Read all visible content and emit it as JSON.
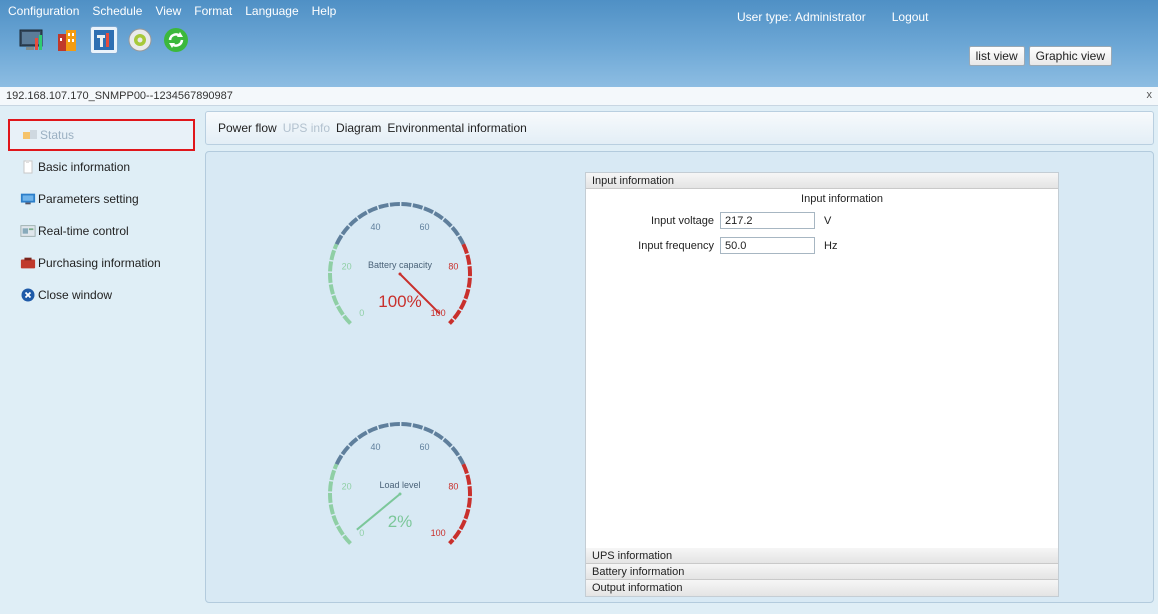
{
  "menu": [
    "Configuration",
    "Schedule",
    "View",
    "Format",
    "Language",
    "Help"
  ],
  "user": {
    "type_label": "User type:",
    "type_value": "Administrator",
    "logout": "Logout"
  },
  "toolbar_icons": [
    "monitor-chart-icon",
    "building-icon",
    "tools-icon",
    "gear-disc-icon",
    "refresh-icon"
  ],
  "view_buttons": {
    "list": "list view",
    "graphic": "Graphic view"
  },
  "address": "192.168.107.170_SNMPP00--1234567890987",
  "close_label": "x",
  "sidebar": [
    {
      "label": "Status",
      "icon": "status-icon",
      "active": true
    },
    {
      "label": "Basic information",
      "icon": "document-icon"
    },
    {
      "label": "Parameters setting",
      "icon": "monitor-icon"
    },
    {
      "label": "Real-time control",
      "icon": "control-icon"
    },
    {
      "label": "Purchasing information",
      "icon": "cart-icon"
    },
    {
      "label": "Close window",
      "icon": "close-circle-icon"
    }
  ],
  "tabs": [
    {
      "label": "Power flow",
      "dim": false
    },
    {
      "label": "UPS info",
      "dim": true
    },
    {
      "label": "Diagram",
      "dim": false
    },
    {
      "label": "Environmental information",
      "dim": false
    }
  ],
  "gauges": [
    {
      "name": "Battery capacity",
      "value": 100,
      "value_text": "100%",
      "color": "#c9302c",
      "ticks": [
        "0",
        "20",
        "40",
        "60",
        "80",
        "100"
      ]
    },
    {
      "name": "Load level",
      "value": 2,
      "value_text": "2%",
      "color": "#7cc79a",
      "ticks": [
        "0",
        "20",
        "40",
        "60",
        "80",
        "100"
      ]
    }
  ],
  "accordion": {
    "input_header": "Input information",
    "input_title": "Input information",
    "input_voltage_label": "Input voltage",
    "input_voltage_value": "217.2",
    "input_voltage_unit": "V",
    "input_frequency_label": "Input frequency",
    "input_frequency_value": "50.0",
    "input_frequency_unit": "Hz",
    "ups_header": "UPS information",
    "battery_header": "Battery information",
    "output_header": "Output information"
  },
  "colors": {
    "header": "#5f9dcf",
    "active_border": "#e0161b",
    "panel": "#d8e9f4"
  }
}
